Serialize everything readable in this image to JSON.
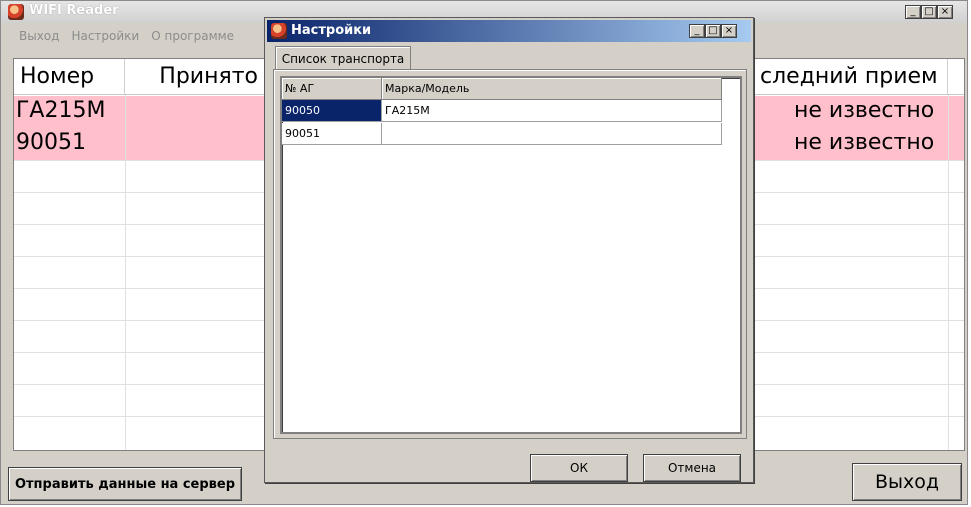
{
  "main_window": {
    "title": "WIFI Reader",
    "menu": [
      "Выход",
      "Настройки",
      "О программе"
    ],
    "grid": {
      "headers": [
        "Номер",
        "Принято",
        "следний прием"
      ],
      "rows": [
        {
          "number": "ГА215М",
          "last": "не известно"
        },
        {
          "number": "90051",
          "last": "не известно"
        }
      ]
    },
    "send_button": "Отправить данные на сервер",
    "exit_button": "Выход"
  },
  "dialog": {
    "title": "Настройки",
    "tab": "Список транспорта",
    "grid": {
      "headers": [
        "№ АГ",
        "Марка/Модель"
      ],
      "rows": [
        {
          "id": "90050",
          "model": "ГА215М"
        },
        {
          "id": "90051",
          "model": ""
        }
      ]
    },
    "ok_button": "ОК",
    "cancel_button": "Отмена"
  },
  "colors": {
    "row_highlight": "#ffc0cb",
    "selection": "#0a246a",
    "titlebar_active": "#0a246a"
  },
  "icons": {
    "app": "helmet-icon",
    "minimize": "minimize-icon",
    "maximize": "maximize-icon",
    "close": "close-icon"
  }
}
